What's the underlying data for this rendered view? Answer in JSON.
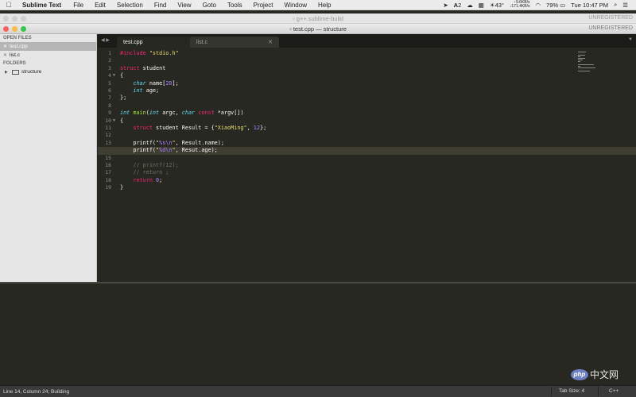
{
  "menubar": {
    "app_name": "Sublime Text",
    "menus": [
      "File",
      "Edit",
      "Selection",
      "Find",
      "View",
      "Goto",
      "Tools",
      "Project",
      "Window",
      "Help"
    ],
    "adobe_badge": "2",
    "temperature": "43°",
    "net_up": "9.6KB/s",
    "net_down": "171.4KB/s",
    "battery": "79%",
    "clock": "Tue 10:47 PM"
  },
  "back_window": {
    "title": "g++.sublime-build",
    "status": "UNREGISTERED"
  },
  "main_window": {
    "title": "test.cpp — structure",
    "status": "UNREGISTERED"
  },
  "sidebar": {
    "open_files_header": "OPEN FILES",
    "open_files": [
      {
        "name": "test.cpp",
        "active": true
      },
      {
        "name": "list.c",
        "active": false
      }
    ],
    "folders_header": "FOLDERS",
    "folders": [
      {
        "name": "structure"
      }
    ]
  },
  "tabs": [
    {
      "label": "test.cpp",
      "active": true
    },
    {
      "label": "list.c",
      "active": false
    }
  ],
  "editor": {
    "current_line": 14,
    "fold_lines": [
      4,
      10
    ],
    "lines": [
      "#include \"stdio.h\"",
      "",
      "struct student",
      "{",
      "    char name[20];",
      "    int age;",
      "};",
      "",
      "int main(int argc, char const *argv[])",
      "{",
      "    struct student Result = {\"XiaoMing\", 12};",
      "",
      "    printf(\"%s\\n\", Result.name);",
      "    printf(\"%d\\n\", Resut.age);",
      "",
      "    // printf(12);",
      "    // return ;",
      "    return 0;",
      "}"
    ]
  },
  "statusbar": {
    "position": "Line 14, Column 24; Building",
    "tab_size": "Tab Size: 4",
    "syntax": "C++"
  },
  "watermark": {
    "logo": "php",
    "text": "中文网"
  },
  "colors": {
    "background": "#272822",
    "keyword": "#f92672",
    "type": "#66d9ef",
    "string": "#e6db74",
    "number": "#ae81ff",
    "comment": "#75715e",
    "close_red": "#fc605b",
    "min_yellow": "#fdbc40",
    "zoom_green": "#34c84a"
  }
}
